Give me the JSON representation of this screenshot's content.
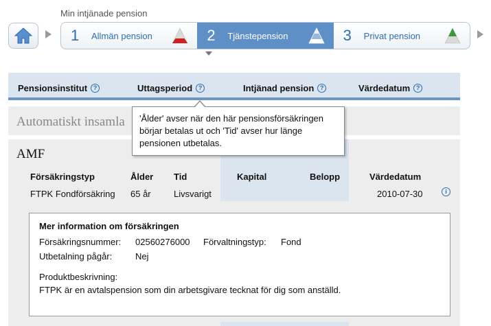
{
  "breadcrumb": {
    "title": "Min intjänade pension"
  },
  "steps": [
    {
      "number": "1",
      "label": "Allmän pension",
      "active": false,
      "pyramid": "red"
    },
    {
      "number": "2",
      "label": "Tjänstepension",
      "active": true,
      "pyramid": "blue"
    },
    {
      "number": "3",
      "label": "Privat pension",
      "active": false,
      "pyramid": "green"
    }
  ],
  "colors": {
    "accent": "#5e8fc7",
    "header_bg": "#dbe5f0",
    "link": "#2a6fb0",
    "pyramid_red": "#cc2222",
    "pyramid_blue": "#9ab8dc",
    "pyramid_green": "#3a9a3a"
  },
  "table": {
    "headers": [
      "Pensionsinstitut",
      "Uttagsperiod",
      "Intjänad pension",
      "Värdedatum"
    ],
    "help_glyph": "?"
  },
  "auto_row": {
    "label": "Automatiskt insamla"
  },
  "tooltip": {
    "text": "'Ålder' avser när den här pensionsförsäkringen börjar betalas ut och 'Tid' avser hur länge pensionen utbetalas."
  },
  "amf": {
    "title": "AMF",
    "columns": [
      "Försäkringstyp",
      "Ålder",
      "Tid",
      "Kapital",
      "Belopp",
      "Värdedatum"
    ],
    "row": {
      "type": "FTPK Fondförsäkring",
      "age": "65 år",
      "period": "Livsvarigt",
      "capital": "",
      "amount": "",
      "date": "2010-07-30"
    },
    "info_glyph": "i",
    "details": {
      "title": "Mer information om försäkringen",
      "policy_number_label": "Försäkringsnummer:",
      "policy_number": "02560276000",
      "management_label": "Förvaltningstyp:",
      "management": "Fond",
      "payout_label": "Utbetalning pågår:",
      "payout": "Nej",
      "description_label": "Produktbeskrivning:",
      "description": "FTPK är en avtalspension som din arbetsgivare tecknat för dig som anställd."
    }
  }
}
